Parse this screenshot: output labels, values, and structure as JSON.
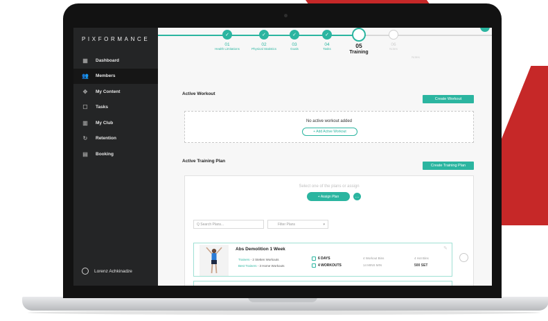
{
  "brand": {
    "logo_text": "PIXFORMANCE",
    "accent_color": "#2bb5a0",
    "decor_color": "#c62828"
  },
  "sidebar": {
    "items": [
      {
        "label": "Dashboard",
        "icon": "grid-icon",
        "active": false
      },
      {
        "label": "Members",
        "icon": "members-icon",
        "active": true
      },
      {
        "label": "My Content",
        "icon": "content-icon",
        "active": false
      },
      {
        "label": "Tasks",
        "icon": "tasks-icon",
        "active": false
      },
      {
        "label": "My Club",
        "icon": "club-icon",
        "active": false
      },
      {
        "label": "Retention",
        "icon": "retention-icon",
        "active": false
      },
      {
        "label": "Booking",
        "icon": "calendar-icon",
        "active": false
      }
    ],
    "user_name": "Lorenz Achkinadze"
  },
  "stepper": {
    "steps": [
      {
        "num": "01",
        "name": "Health Limitations",
        "state": "done"
      },
      {
        "num": "02",
        "name": "Physical Statistics",
        "state": "done"
      },
      {
        "num": "03",
        "name": "Goals",
        "state": "done"
      },
      {
        "num": "04",
        "name": "Tasks",
        "state": "done"
      },
      {
        "num": "05",
        "name": "Training",
        "state": "current"
      },
      {
        "num": "06",
        "name": "Notes",
        "state": "todo"
      }
    ],
    "trailing_label": "Notes"
  },
  "active_workout": {
    "title": "Active Workout",
    "create_button": "Create Workout",
    "empty_text": "No active workout added",
    "add_button": "+  Add Active Workout"
  },
  "training_plan": {
    "title": "Active Training Plan",
    "create_button": "Create Training Plan",
    "hint": "Select one of the plans or assign",
    "assign_button": "+  Assign Plan",
    "search_placeholder": "Q  Search Plans...",
    "filter_placeholder": "Filter Plans",
    "plan": {
      "title": "Abs Demolition 1 Week",
      "line1_tag": "Trainers",
      "line1_text": " - 2 Stetten Workouts",
      "line2_tag": "Best Trainers",
      "line2_text": " - 3 Home Workouts",
      "days": "6 DAYS",
      "workouts": "4 WORKOUTS",
      "meta1_label": "4 Workout Bins",
      "meta1_value": "14 MINS MIN",
      "meta2_label": "4 Hot Bins",
      "meta2_value": "500 SET"
    }
  }
}
